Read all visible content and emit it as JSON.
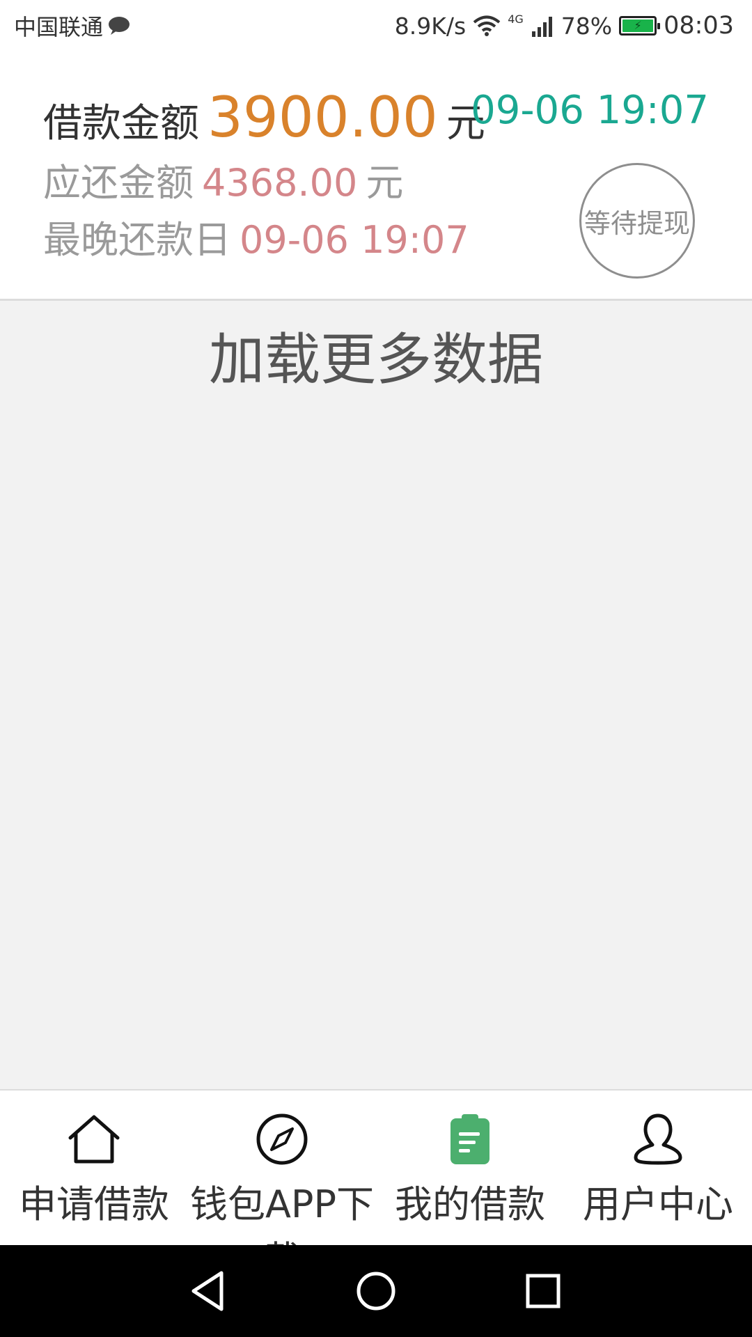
{
  "status_bar": {
    "carrier": "中国联通",
    "net_speed": "8.9K/s",
    "network_type": "4G",
    "battery_percent": "78%",
    "time": "08:03",
    "icons": [
      "chat-bubble-icon",
      "wifi-icon",
      "signal-icon",
      "battery-charging-icon"
    ]
  },
  "loan": {
    "amount_label": "借款金额",
    "amount_value": "3900.00",
    "amount_unit": "元",
    "loan_datetime": "09-06 19:07",
    "repay_label": "应还金额",
    "repay_value": "4368.00",
    "repay_unit": "元",
    "due_label": "最晚还款日",
    "due_value": "09-06 19:07",
    "status": "等待提现"
  },
  "content": {
    "load_more": "加载更多数据"
  },
  "tabs": [
    {
      "label": "申请借款",
      "icon": "home-icon",
      "active": false
    },
    {
      "label": "钱包APP下载",
      "icon": "compass-icon",
      "active": false
    },
    {
      "label": "我的借款",
      "icon": "clipboard-icon",
      "active": true
    },
    {
      "label": "用户中心",
      "icon": "user-icon",
      "active": false
    }
  ],
  "colors": {
    "amount": "#d9822b",
    "datetime": "#1aa891",
    "repay": "#d4868a",
    "active_tab_icon": "#4caf6e"
  },
  "system_nav": [
    "back-icon",
    "home-circle-icon",
    "recents-icon"
  ]
}
